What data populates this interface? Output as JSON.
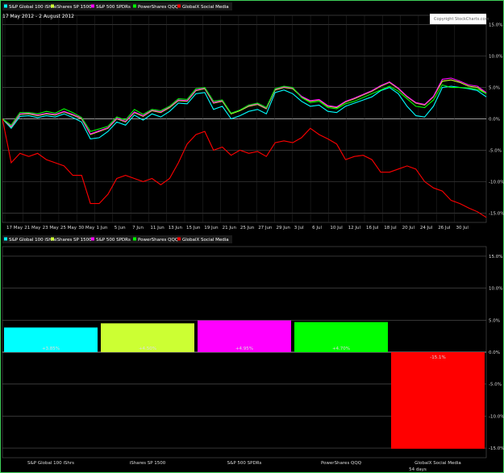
{
  "chart_data": [
    {
      "type": "line",
      "subtitle": "17 May 2012 - 2 August 2012",
      "watermark": "Copyright StockCharts.com",
      "grid": true,
      "legend_position": "top-left",
      "x_tick_labels": [
        "17 May",
        "21 May",
        "23 May",
        "25 May",
        "30 May",
        "1 Jun",
        "5 Jun",
        "7 Jun",
        "11 Jun",
        "13 Jun",
        "15 Jun",
        "19 Jun",
        "21 Jun",
        "25 Jun",
        "27 Jun",
        "29 Jun",
        "3 Jul",
        "6 Jul",
        "10 Jul",
        "12 Jul",
        "16 Jul",
        "18 Jul",
        "20 Jul",
        "24 Jul",
        "26 Jul",
        "30 Jul"
      ],
      "y_tick_labels": [
        "15.0%",
        "10.0%",
        "5.0%",
        "0.0%",
        "-5.0%",
        "-10.0%",
        "-15.0%"
      ],
      "ylim": [
        -16.5,
        16.5
      ],
      "series": [
        {
          "name": "S&P Global 100 iShrs",
          "color": "#00ffff",
          "values": [
            0,
            -1.5,
            0.4,
            0.5,
            0.2,
            0.5,
            0.3,
            0.8,
            0.2,
            -0.5,
            -3.2,
            -3.0,
            -2.0,
            -0.5,
            -1.0,
            0.6,
            -0.2,
            0.8,
            0.3,
            1.2,
            2.5,
            2.4,
            4.0,
            4.2,
            1.5,
            2.0,
            0.0,
            0.5,
            1.2,
            1.5,
            0.8,
            4.2,
            4.6,
            4.0,
            2.8,
            2.0,
            2.2,
            1.2,
            1.0,
            2.0,
            2.5,
            3.0,
            3.5,
            4.5,
            5.0,
            4.0,
            2.0,
            0.5,
            0.3,
            2.0,
            5.0,
            5.2,
            5.0,
            4.8,
            4.5,
            3.5
          ]
        },
        {
          "name": "iShares SP 1500",
          "color": "#ccff33",
          "values": [
            0,
            -1.3,
            0.7,
            0.8,
            0.5,
            0.8,
            0.6,
            1.1,
            0.6,
            0.0,
            -2.5,
            -2.0,
            -1.5,
            0.0,
            -0.5,
            1.0,
            0.4,
            1.3,
            1.0,
            1.8,
            2.9,
            2.8,
            4.5,
            4.8,
            2.5,
            2.8,
            0.8,
            1.3,
            2.0,
            2.3,
            1.6,
            4.6,
            5.0,
            4.8,
            3.5,
            2.8,
            3.0,
            2.0,
            1.8,
            2.7,
            3.2,
            3.8,
            4.4,
            5.2,
            5.8,
            4.8,
            3.5,
            2.5,
            2.2,
            3.5,
            6.0,
            6.2,
            5.8,
            5.2,
            5.0,
            4.0
          ]
        },
        {
          "name": "S&P 500 SPDRs",
          "color": "#ff00ff",
          "values": [
            0,
            -1.2,
            0.8,
            0.9,
            0.6,
            0.9,
            0.7,
            1.2,
            0.7,
            0.1,
            -2.4,
            -1.9,
            -1.4,
            0.1,
            -0.4,
            1.1,
            0.5,
            1.4,
            1.1,
            1.9,
            3.0,
            2.9,
            4.6,
            4.9,
            2.6,
            2.9,
            0.9,
            1.4,
            2.1,
            2.4,
            1.7,
            4.7,
            5.1,
            4.9,
            3.6,
            2.9,
            3.1,
            2.1,
            1.9,
            2.8,
            3.3,
            3.9,
            4.5,
            5.3,
            5.9,
            4.9,
            3.6,
            2.6,
            2.3,
            3.6,
            6.3,
            6.5,
            6.0,
            5.4,
            5.2,
            4.2
          ]
        },
        {
          "name": "PowerShares QQQ",
          "color": "#00ff00",
          "values": [
            0,
            -1.0,
            1.0,
            1.0,
            0.8,
            1.2,
            0.9,
            1.6,
            1.0,
            0.2,
            -2.0,
            -1.6,
            -1.2,
            0.3,
            -0.2,
            1.5,
            0.7,
            1.5,
            1.3,
            2.0,
            3.2,
            3.1,
            4.8,
            5.0,
            2.8,
            3.0,
            0.9,
            1.4,
            2.2,
            2.5,
            1.8,
            4.8,
            5.2,
            5.0,
            3.4,
            2.6,
            2.8,
            1.8,
            1.6,
            2.4,
            2.8,
            3.4,
            4.0,
            4.6,
            5.2,
            4.4,
            3.2,
            2.0,
            1.8,
            3.0,
            5.4,
            5.0,
            5.0,
            4.9,
            4.7,
            4.0
          ]
        },
        {
          "name": "GlobalX Social Media",
          "color": "#ff0000",
          "values": [
            0,
            -7.0,
            -5.5,
            -6.0,
            -5.5,
            -6.5,
            -7.0,
            -7.5,
            -9.0,
            -9.0,
            -13.5,
            -13.5,
            -12.0,
            -9.5,
            -9.0,
            -9.5,
            -10.0,
            -9.5,
            -10.5,
            -9.5,
            -7.0,
            -4.0,
            -2.5,
            -2.0,
            -5.0,
            -4.5,
            -5.8,
            -5.0,
            -5.5,
            -5.2,
            -6.0,
            -3.8,
            -3.5,
            -3.8,
            -3.0,
            -1.5,
            -2.5,
            -3.2,
            -4.0,
            -6.5,
            -6.0,
            -5.8,
            -6.5,
            -8.5,
            -8.5,
            -8.0,
            -7.5,
            -8.0,
            -10.0,
            -11.0,
            -11.5,
            -13.0,
            -13.5,
            -14.2,
            -14.8,
            -15.7
          ]
        }
      ]
    },
    {
      "type": "bar",
      "grid": true,
      "legend_position": "top-left",
      "x_footer": "54 days",
      "categories": [
        "S&P Global 100 iShrs",
        "iShares SP 1500",
        "S&P 500 SPDRs",
        "PowerShares QQQ",
        "GlobalX Social Media"
      ],
      "values": [
        3.85,
        4.5,
        4.95,
        4.7,
        -15.1
      ],
      "value_labels": [
        "+3.85%",
        "+4.50%",
        "+4.95%",
        "+4.70%",
        "-15.1%"
      ],
      "colors": [
        "#00ffff",
        "#ccff33",
        "#ff00ff",
        "#00ff00",
        "#ff0000"
      ],
      "y_tick_labels": [
        "15.0%",
        "10.0%",
        "5.0%",
        "0.0%",
        "-5.0%",
        "-10.0%",
        "-15.0%"
      ],
      "ylim": [
        -16.5,
        16.5
      ]
    }
  ]
}
